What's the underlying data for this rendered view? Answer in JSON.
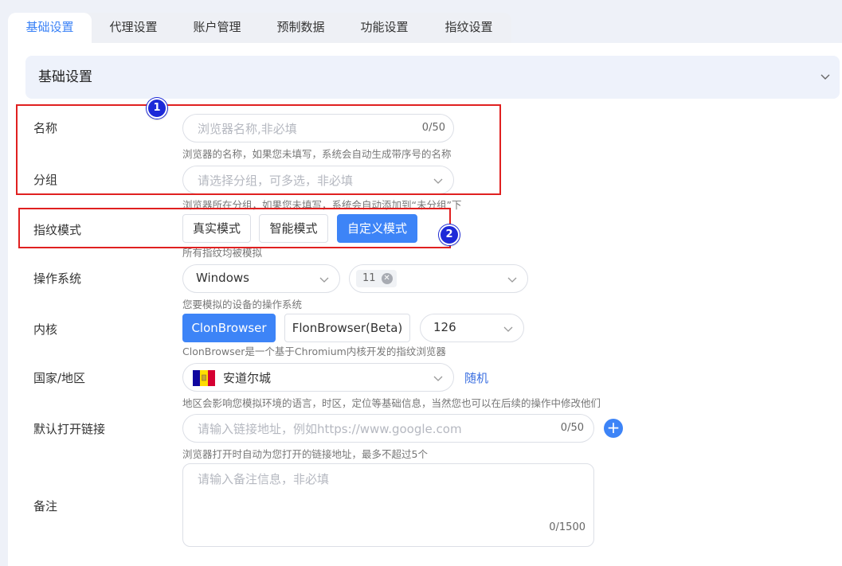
{
  "tabs": [
    "基础设置",
    "代理设置",
    "账户管理",
    "预制数据",
    "功能设置",
    "指纹设置"
  ],
  "section": {
    "title": "基础设置"
  },
  "name": {
    "label": "名称",
    "placeholder": "浏览器名称,非必填",
    "counter": "0/50",
    "help": "浏览器的名称，如果您未填写，系统会自动生成带序号的名称"
  },
  "group": {
    "label": "分组",
    "placeholder": "请选择分组，可多选，非必填",
    "help": "浏览器所在分组，如果您未填写，系统会自动添加到“未分组”下"
  },
  "fingerprint": {
    "label": "指纹模式",
    "options": [
      "真实模式",
      "智能模式",
      "自定义模式"
    ],
    "selected": "自定义模式",
    "help": "所有指纹均被模拟"
  },
  "os": {
    "label": "操作系统",
    "value": "Windows",
    "version_tag": "11",
    "help": "您要模拟的设备的操作系统"
  },
  "kernel": {
    "label": "内核",
    "options": [
      "ClonBrowser",
      "FlonBrowser(Beta)"
    ],
    "selected": "ClonBrowser",
    "version": "126",
    "help": "ClonBrowser是一个基于Chromium内核开发的指纹浏览器"
  },
  "country": {
    "label": "国家/地区",
    "value": "安道尔城",
    "random_label": "随机",
    "help": "地区会影响您模拟环境的语言，时区，定位等基础信息，当然您也可以在后续的操作中修改他们"
  },
  "default_link": {
    "label": "默认打开链接",
    "placeholder": "请输入链接地址，例如https://www.google.com",
    "counter": "0/50",
    "help": "浏览器打开时自动为您打开的链接地址，最多不超过5个"
  },
  "notes": {
    "label": "备注",
    "placeholder": "请输入备注信息，非必填",
    "counter": "0/1500"
  },
  "markers": [
    "1",
    "2"
  ],
  "colors": {
    "accent": "#3d84f7",
    "annotation": "#e02020",
    "marker": "#1d2ad8"
  }
}
